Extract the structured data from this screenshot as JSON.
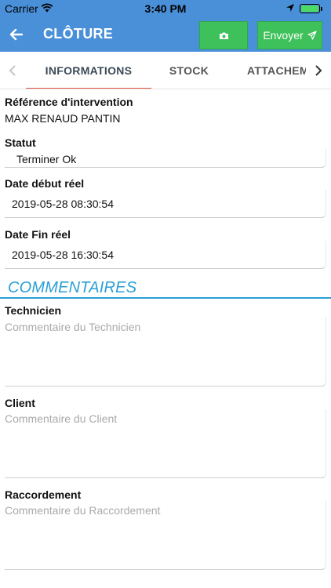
{
  "status_bar": {
    "carrier": "Carrier",
    "time": "3:40 PM",
    "battery_level": 1.0,
    "icons": [
      "wifi-icon",
      "location-arrow-icon",
      "battery-icon"
    ]
  },
  "nav": {
    "title": "CLÔTURE",
    "send_label": "Envoyer",
    "icons": [
      "back-arrow-icon",
      "camera-icon",
      "send-icon"
    ]
  },
  "tabs": {
    "items": [
      "INFORMATIONS",
      "STOCK",
      "ATTACHEMENT"
    ],
    "active": "INFORMATIONS"
  },
  "fields": {
    "reference_label": "Référence d'intervention",
    "reference_value": "MAX RENAUD PANTIN",
    "status_label": "Statut",
    "status_value": "Terminer Ok",
    "start_label": "Date début réel",
    "start_value": "2019-05-28 08:30:54",
    "end_label": "Date Fin réel",
    "end_value": "2019-05-28 16:30:54"
  },
  "comments": {
    "section_title": "COMMENTAIRES",
    "technicien_label": "Technicien",
    "technicien_placeholder": "Commentaire du Technicien",
    "client_label": "Client",
    "client_placeholder": "Commentaire du Client",
    "raccordement_label": "Raccordement",
    "raccordement_placeholder": "Commentaire du Raccordement"
  },
  "colors": {
    "header_blue": "#4a90d9",
    "button_green": "#3ec15a",
    "tab_underline": "#e5533c",
    "section_blue": "#2a9fd6"
  }
}
